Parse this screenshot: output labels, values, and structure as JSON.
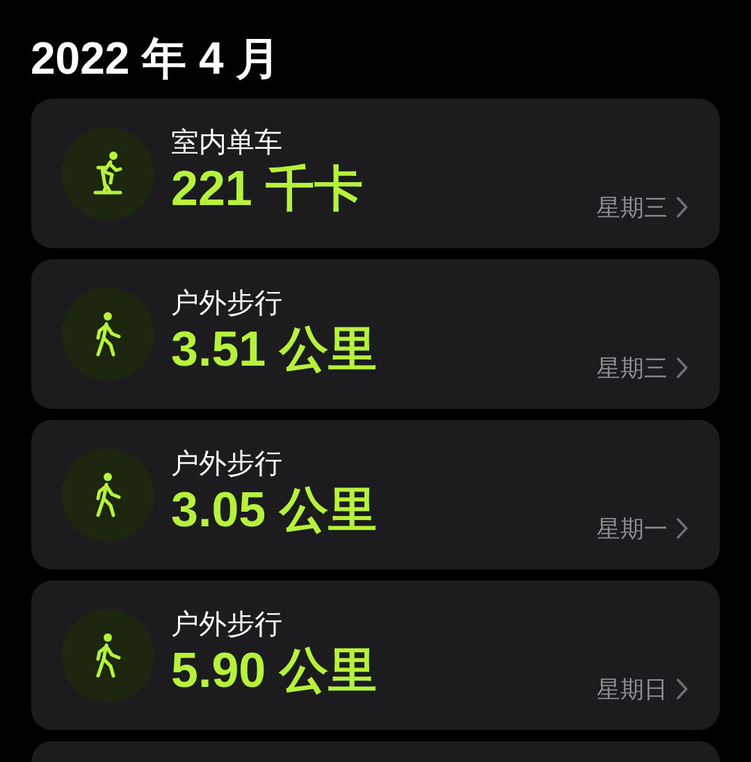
{
  "title": "2022 年 4 月",
  "workouts": [
    {
      "kind": "cycling",
      "name": "室内单车",
      "value": "221 千卡",
      "day": "星期三"
    },
    {
      "kind": "walking",
      "name": "户外步行",
      "value": "3.51 公里",
      "day": "星期三"
    },
    {
      "kind": "walking",
      "name": "户外步行",
      "value": "3.05 公里",
      "day": "星期一"
    },
    {
      "kind": "walking",
      "name": "户外步行",
      "value": "5.90 公里",
      "day": "星期日"
    }
  ]
}
